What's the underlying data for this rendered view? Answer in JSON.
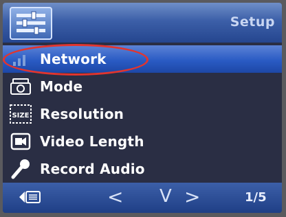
{
  "header": {
    "icon": "settings-sliders-icon",
    "title": "Setup"
  },
  "menu": {
    "items": [
      {
        "label": "Network",
        "icon": "signal-bars-icon",
        "selected": true
      },
      {
        "label": "Mode",
        "icon": "camera-mode-icon",
        "selected": false
      },
      {
        "label": "Resolution",
        "icon": "size-icon",
        "selected": false
      },
      {
        "label": "Video Length",
        "icon": "video-clip-icon",
        "selected": false
      },
      {
        "label": "Record Audio",
        "icon": "microphone-icon",
        "selected": false
      }
    ],
    "icon_text_size": "SIZE"
  },
  "footer": {
    "back_icon": "back-icon",
    "prev_symbol": "<",
    "down_symbol": "V",
    "next_symbol": ">",
    "page": "1/5"
  },
  "colors": {
    "selection": "#2a5bc4",
    "annotation": "#e2352e",
    "background": "#2a2e44"
  }
}
